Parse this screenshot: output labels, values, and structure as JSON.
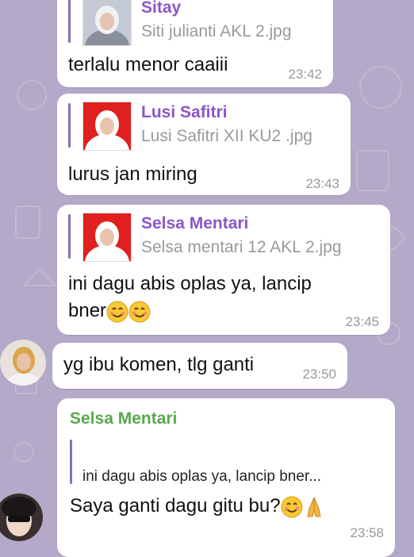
{
  "messages": [
    {
      "reply": {
        "name": "Sitay",
        "file": "Siti julianti AKL 2.jpg"
      },
      "text": "terlalu menor caaiii",
      "time": "23:42"
    },
    {
      "reply": {
        "name": "Lusi Safitri",
        "file": "Lusi Safitri XII KU2 .jpg"
      },
      "text": "lurus jan miring",
      "time": "23:43"
    },
    {
      "reply": {
        "name": "Selsa Mentari",
        "file": "Selsa mentari 12 AKL 2.jpg"
      },
      "text_line1": "ini dagu abis oplas ya, lancip",
      "text_line2": "bner",
      "time": "23:45"
    },
    {
      "text": "yg ibu komen, tlg ganti",
      "time": "23:50"
    },
    {
      "sender": "Selsa Mentari",
      "quote": "ini dagu abis oplas ya, lancip bner...",
      "text": "Saya ganti dagu gitu bu?",
      "time": "23:58"
    }
  ],
  "colors": {
    "background": "#b4a9c8",
    "reply_name": "#8b55c9",
    "sender_name": "#59a84a",
    "reply_bar": "#8a6fb6"
  },
  "icons": [
    "smiling-face-emoji",
    "folded-hands-emoji"
  ]
}
